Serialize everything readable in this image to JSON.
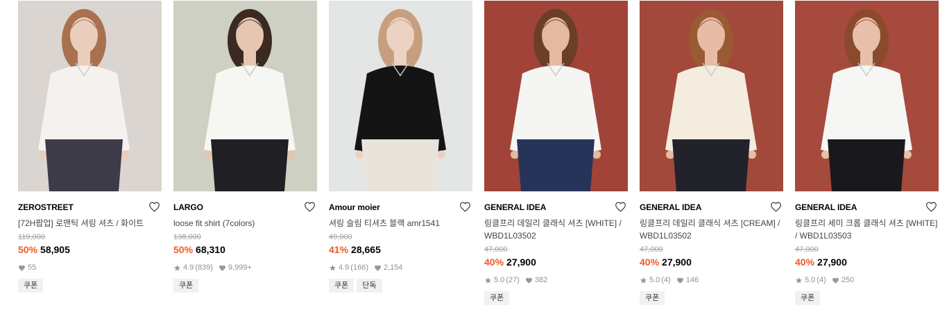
{
  "products": [
    {
      "brand": "ZEROSTREET",
      "name": "[72H팝업] 로맨틱 셔링 셔츠 / 화이트",
      "original_price": "119,000",
      "discount": "50%",
      "price": "58,905",
      "rating": "",
      "reviews": "",
      "likes": "55",
      "badges": [
        "쿠폰"
      ],
      "image": {
        "bg": "#d8d2cf",
        "top": "#f4f1ee",
        "bottom": "#3d3b48",
        "skin": "#e9cdbd",
        "hair": "#a9714e"
      }
    },
    {
      "brand": "LARGO",
      "name": "loose fit shirt (7colors)",
      "original_price": "138,000",
      "discount": "50%",
      "price": "68,310",
      "rating": "4.9",
      "reviews": "(839)",
      "likes": "9,999+",
      "badges": [
        "쿠폰"
      ],
      "image": {
        "bg": "#c9cdbd",
        "top": "#f6f6f3",
        "bottom": "#1f1f24",
        "skin": "#e6c6b0",
        "hair": "#3b2a22"
      }
    },
    {
      "brand": "Amour moier",
      "name": "셔링 슬림 티셔츠 블랙 amr1541",
      "original_price": "49,000",
      "discount": "41%",
      "price": "28,665",
      "rating": "4.9",
      "reviews": "(166)",
      "likes": "2,154",
      "badges": [
        "쿠폰",
        "단독"
      ],
      "image": {
        "bg": "#e2e3e3",
        "top": "#141414",
        "bottom": "#e8e4dc",
        "skin": "#ecd2c3",
        "hair": "#c79f7e"
      }
    },
    {
      "brand": "GENERAL IDEA",
      "name": "링클프리 데일리 클래식 셔츠 [WHITE] / WBD1L03502",
      "original_price": "47,000",
      "discount": "40%",
      "price": "27,900",
      "rating": "5.0",
      "reviews": "(27)",
      "likes": "382",
      "badges": [
        "쿠폰"
      ],
      "image": {
        "bg": "#9a3328",
        "top": "#f5f5f4",
        "bottom": "#26345a",
        "skin": "#e3b9a0",
        "hair": "#6b3f27"
      }
    },
    {
      "brand": "GENERAL IDEA",
      "name": "링클프리 데일리 클래식 셔츠 [CREAM] / WBD1L03502",
      "original_price": "47,000",
      "discount": "40%",
      "price": "27,900",
      "rating": "5.0",
      "reviews": "(4)",
      "likes": "146",
      "badges": [
        "쿠폰"
      ],
      "image": {
        "bg": "#9b3a2b",
        "top": "#f4ecdf",
        "bottom": "#22232a",
        "skin": "#e6bca6",
        "hair": "#9a5a34"
      }
    },
    {
      "brand": "GENERAL IDEA",
      "name": "링클프리 세미 크롭 클래식 셔츠 [WHITE] / WBD1L03503",
      "original_price": "47,000",
      "discount": "40%",
      "price": "27,900",
      "rating": "5.0",
      "reviews": "(4)",
      "likes": "250",
      "badges": [
        "쿠폰"
      ],
      "image": {
        "bg": "#9e3b2c",
        "top": "#f6f6f5",
        "bottom": "#19191c",
        "skin": "#e8c0aa",
        "hair": "#8b4a2e"
      }
    }
  ],
  "colors": {
    "discount": "#f15a24",
    "muted": "#a0a0a0"
  }
}
